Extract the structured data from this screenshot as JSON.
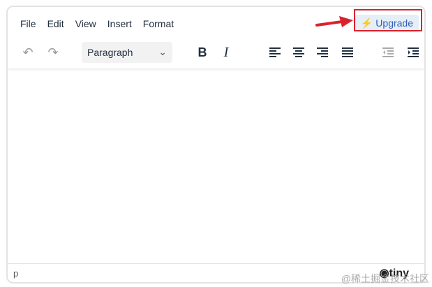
{
  "menubar": {
    "items": [
      "File",
      "Edit",
      "View",
      "Insert",
      "Format"
    ]
  },
  "upgrade": {
    "label": "Upgrade",
    "icon": "bolt-icon"
  },
  "toolbar": {
    "block_format": "Paragraph"
  },
  "statusbar": {
    "path": "p",
    "brand": "tiny"
  },
  "watermark": "@稀土掘金技术社区",
  "colors": {
    "highlight": "#d9232c",
    "upgrade_bg": "#e6eef8",
    "upgrade_text": "#2e5fb4"
  }
}
